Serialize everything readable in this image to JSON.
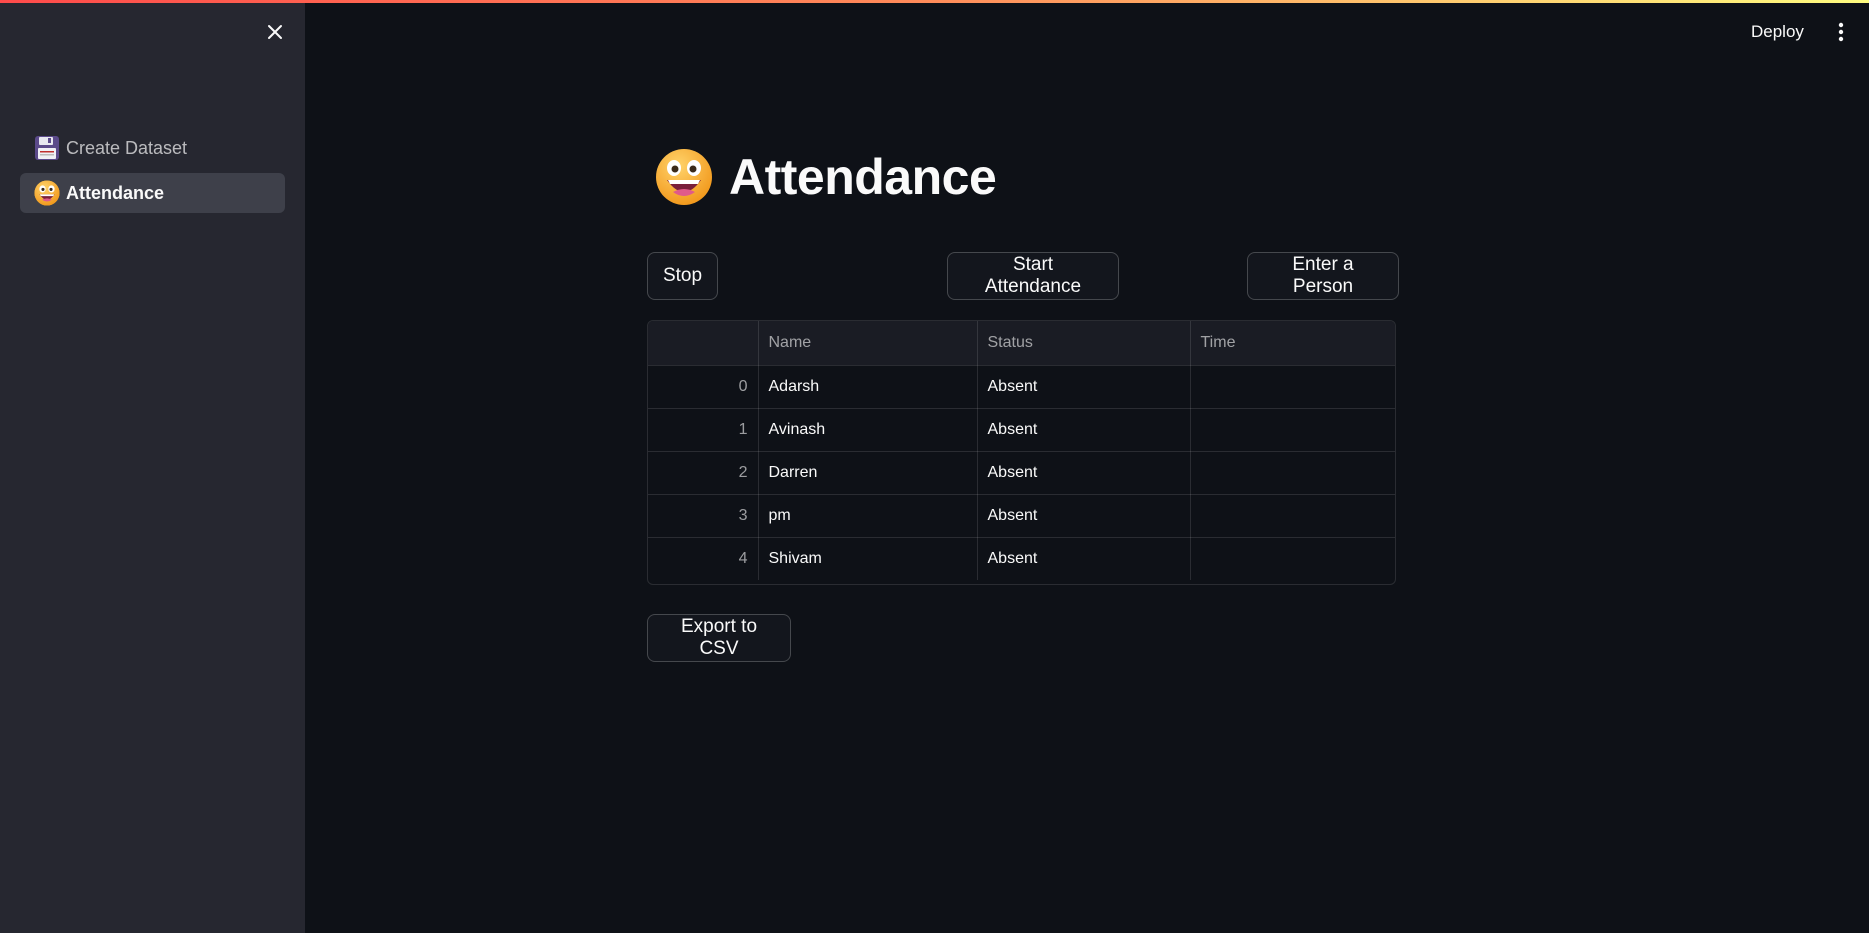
{
  "sidebar": {
    "items": [
      {
        "label": "Create Dataset",
        "icon": "floppy-disk-icon",
        "active": false
      },
      {
        "label": "Attendance",
        "icon": "grinning-face-icon",
        "active": true
      }
    ]
  },
  "header": {
    "deploy_label": "Deploy",
    "menu_icon": "vertical-ellipsis-icon"
  },
  "main": {
    "title": "Attendance",
    "title_icon": "grinning-face-icon",
    "buttons": {
      "stop": "Stop",
      "start": "Start Attendance",
      "enter": "Enter a Person",
      "export": "Export to CSV"
    },
    "table": {
      "columns": [
        "",
        "Name",
        "Status",
        "Time"
      ],
      "rows": [
        {
          "index": "0",
          "name": "Adarsh",
          "status": "Absent",
          "time": ""
        },
        {
          "index": "1",
          "name": "Avinash",
          "status": "Absent",
          "time": ""
        },
        {
          "index": "2",
          "name": "Darren",
          "status": "Absent",
          "time": ""
        },
        {
          "index": "3",
          "name": "pm",
          "status": "Absent",
          "time": ""
        },
        {
          "index": "4",
          "name": "Shivam",
          "status": "Absent",
          "time": ""
        }
      ]
    }
  },
  "colors": {
    "background": "#0e1117",
    "sidebar": "#262730",
    "accent_gradient_start": "#ff4b4b",
    "accent_gradient_end": "#fffd80"
  }
}
